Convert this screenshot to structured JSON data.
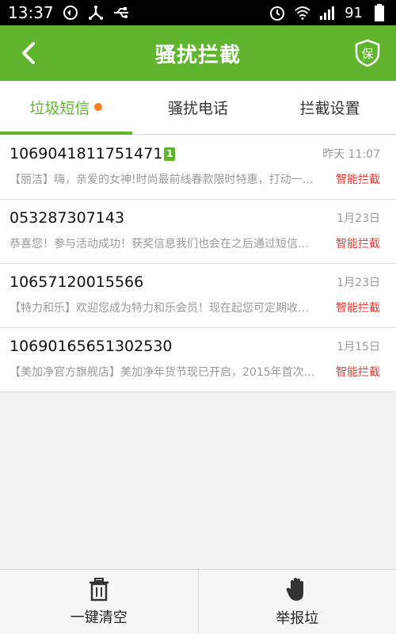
{
  "status_bar": {
    "time": "13:37",
    "battery": "91",
    "left_icons": [
      "sync-icon",
      "usb-tether-icon",
      "usb-icon"
    ],
    "right_icons": [
      "alarm-icon",
      "wifi-icon",
      "signal-icon",
      "battery-icon"
    ]
  },
  "header": {
    "title": "骚扰拦截",
    "shield_label": "保",
    "bg_color": "#5fb52d"
  },
  "tabs": [
    {
      "label": "垃圾短信",
      "active": true,
      "has_dot": true
    },
    {
      "label": "骚扰电话",
      "active": false
    },
    {
      "label": "拦截设置",
      "active": false
    }
  ],
  "messages": [
    {
      "number": "1069041811751471",
      "badge": "1",
      "time": "昨天 11:07",
      "preview": "【丽洁】嗨，亲爱的女神!时尚最前线春款限时特惠，打动一…",
      "tag": "智能拦截"
    },
    {
      "number": "053287307143",
      "time": "1月23日",
      "preview": "恭喜您！参与活动成功！获奖信息我们也会在之后通过短信…",
      "tag": "智能拦截"
    },
    {
      "number": "10657120015566",
      "time": "1月23日",
      "preview": "【特力和乐】欢迎您成为特力和乐会员！现在起您可定期收…",
      "tag": "智能拦截"
    },
    {
      "number": "10690165651302530",
      "time": "1月15日",
      "preview": "【美加净官方旗舰店】美加净年货节现已开启，2015年首次…",
      "tag": "智能拦截"
    }
  ],
  "bottom_bar": {
    "clear_label": "一键清空",
    "report_label": "举报垃"
  },
  "colors": {
    "accent": "#5fb52d",
    "tag_red": "#e53935",
    "dot_orange": "#ff7a1a"
  }
}
